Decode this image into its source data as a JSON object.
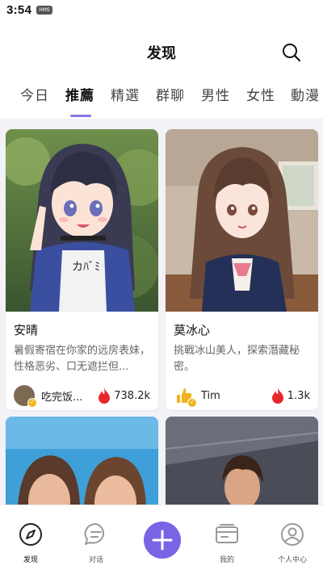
{
  "status_bar": {
    "time": "3:54",
    "badge": "HMS"
  },
  "header": {
    "title": "发现"
  },
  "tabs": [
    {
      "label": "今日"
    },
    {
      "label": "推薦"
    },
    {
      "label": "精選"
    },
    {
      "label": "群聊"
    },
    {
      "label": "男性"
    },
    {
      "label": "女性"
    },
    {
      "label": "動漫"
    }
  ],
  "cards": [
    {
      "name": "安晴",
      "description": "暑假寄宿在你家的远房表妹，性格恶劣、口无遮拦但...",
      "author": "吃完饭...",
      "heat": "738.2k"
    },
    {
      "name": "莫冰心",
      "description": "挑戰冰山美人，探索潛藏秘密。",
      "author": "Tim",
      "heat": "1.3k"
    }
  ],
  "bottom_nav": [
    {
      "label": "发现"
    },
    {
      "label": "对话"
    },
    {
      "label": "我的"
    },
    {
      "label": "个人中心"
    }
  ],
  "colors": {
    "accent": "#7b63e6",
    "heat": "#e8262c",
    "verify": "#f2b51e"
  },
  "icons": [
    "search-icon",
    "flame-icon",
    "compass-icon",
    "chat-bubble-icon",
    "plus-icon",
    "wallet-icon",
    "user-icon",
    "verified-badge-icon"
  ]
}
